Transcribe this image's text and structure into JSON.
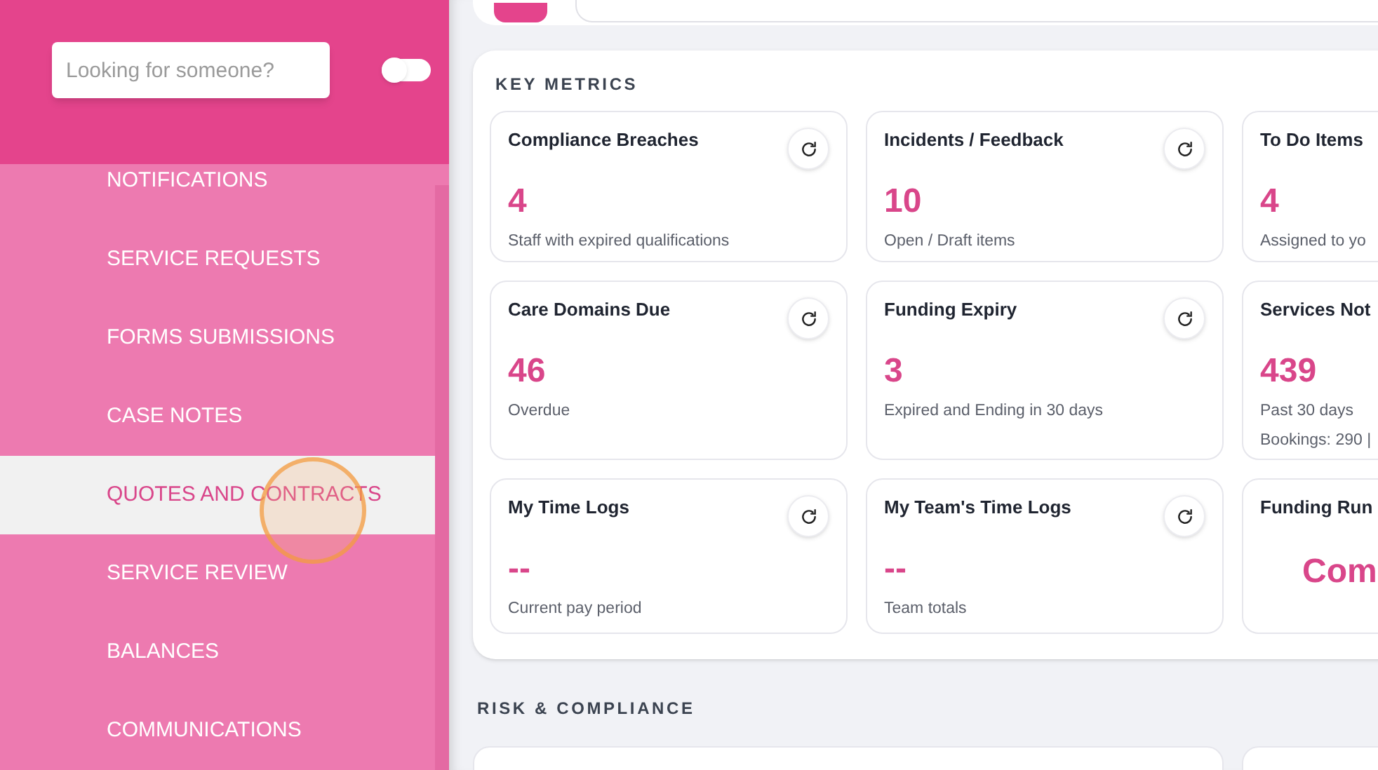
{
  "sidebar": {
    "search": {
      "placeholder": "Looking for someone?"
    },
    "toggle": {
      "on": false
    },
    "items": [
      {
        "label": "NOTIFICATIONS",
        "selected": false
      },
      {
        "label": "SERVICE REQUESTS",
        "selected": false
      },
      {
        "label": "FORMS SUBMISSIONS",
        "selected": false
      },
      {
        "label": "CASE NOTES",
        "selected": false
      },
      {
        "label": "QUOTES AND CONTRACTS",
        "selected": true
      },
      {
        "label": "SERVICE REVIEW",
        "selected": false
      },
      {
        "label": "BALANCES",
        "selected": false
      },
      {
        "label": "COMMUNICATIONS",
        "selected": false
      }
    ]
  },
  "key_metrics": {
    "title": "KEY METRICS",
    "cards": [
      {
        "title": "Compliance Breaches",
        "value": "4",
        "notes": [
          "Staff with expired qualifications"
        ],
        "refresh": true
      },
      {
        "title": "Incidents / Feedback",
        "value": "10",
        "notes": [
          "Open / Draft items"
        ],
        "refresh": true
      },
      {
        "title": "To Do Items",
        "value": "4",
        "notes": [
          "Assigned to yo"
        ],
        "refresh": false
      },
      {
        "title": "Care Domains Due",
        "value": "46",
        "notes": [
          "Overdue"
        ],
        "refresh": true
      },
      {
        "title": "Funding Expiry",
        "value": "3",
        "notes": [
          "Expired and Ending in 30 days"
        ],
        "refresh": true
      },
      {
        "title": "Services Not",
        "value": "439",
        "notes": [
          "Past 30 days",
          "Bookings: 290 |"
        ],
        "refresh": false
      },
      {
        "title": "My Time Logs",
        "value": "--",
        "notes": [
          "Current pay period"
        ],
        "refresh": true
      },
      {
        "title": "My Team's Time Logs",
        "value": "--",
        "notes": [
          "Team totals"
        ],
        "refresh": true
      },
      {
        "title": "Funding Run",
        "value": "Com",
        "refresh": false,
        "centered": true
      }
    ]
  },
  "risk_compliance": {
    "title": "RISK & COMPLIANCE"
  }
}
